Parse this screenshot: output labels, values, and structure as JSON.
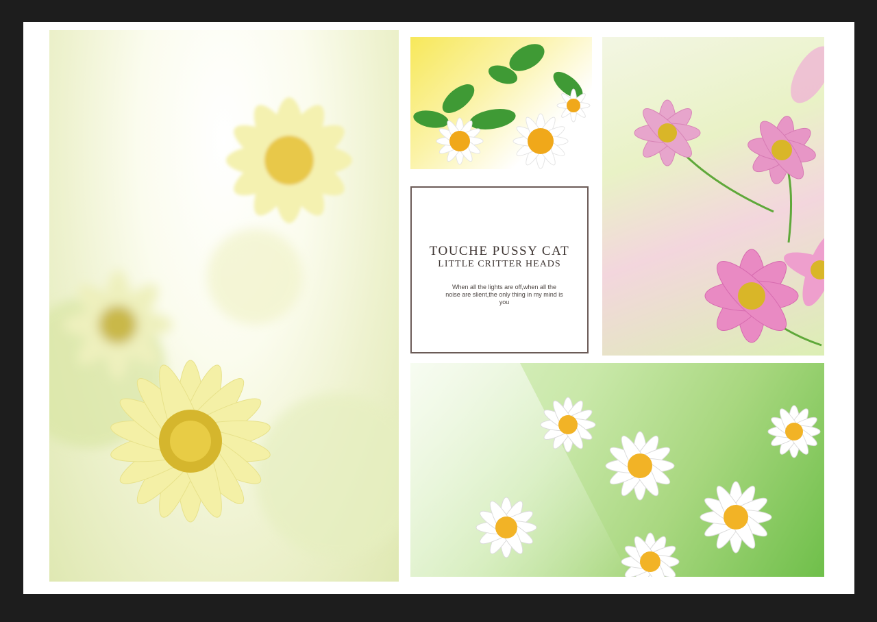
{
  "card": {
    "title": "TOUCHE PUSSY CAT",
    "subtitle": "LITTLE CRITTER HEADS",
    "body": "When all the lights are off,when all the noise are slient,the only thing in my mind is you"
  },
  "colors": {
    "frame": "#1d1d1d",
    "mat": "#ffffff",
    "card_border": "#6b5b57",
    "daisy_yellow": "#f3f0a8",
    "cosmos_pink": "#e59bc6"
  },
  "images": {
    "left": "yellow-daisies-photo",
    "top": "daisies-with-leaves-photo",
    "right": "pink-cosmos-photo",
    "bottom": "white-daisy-meadow-photo"
  }
}
